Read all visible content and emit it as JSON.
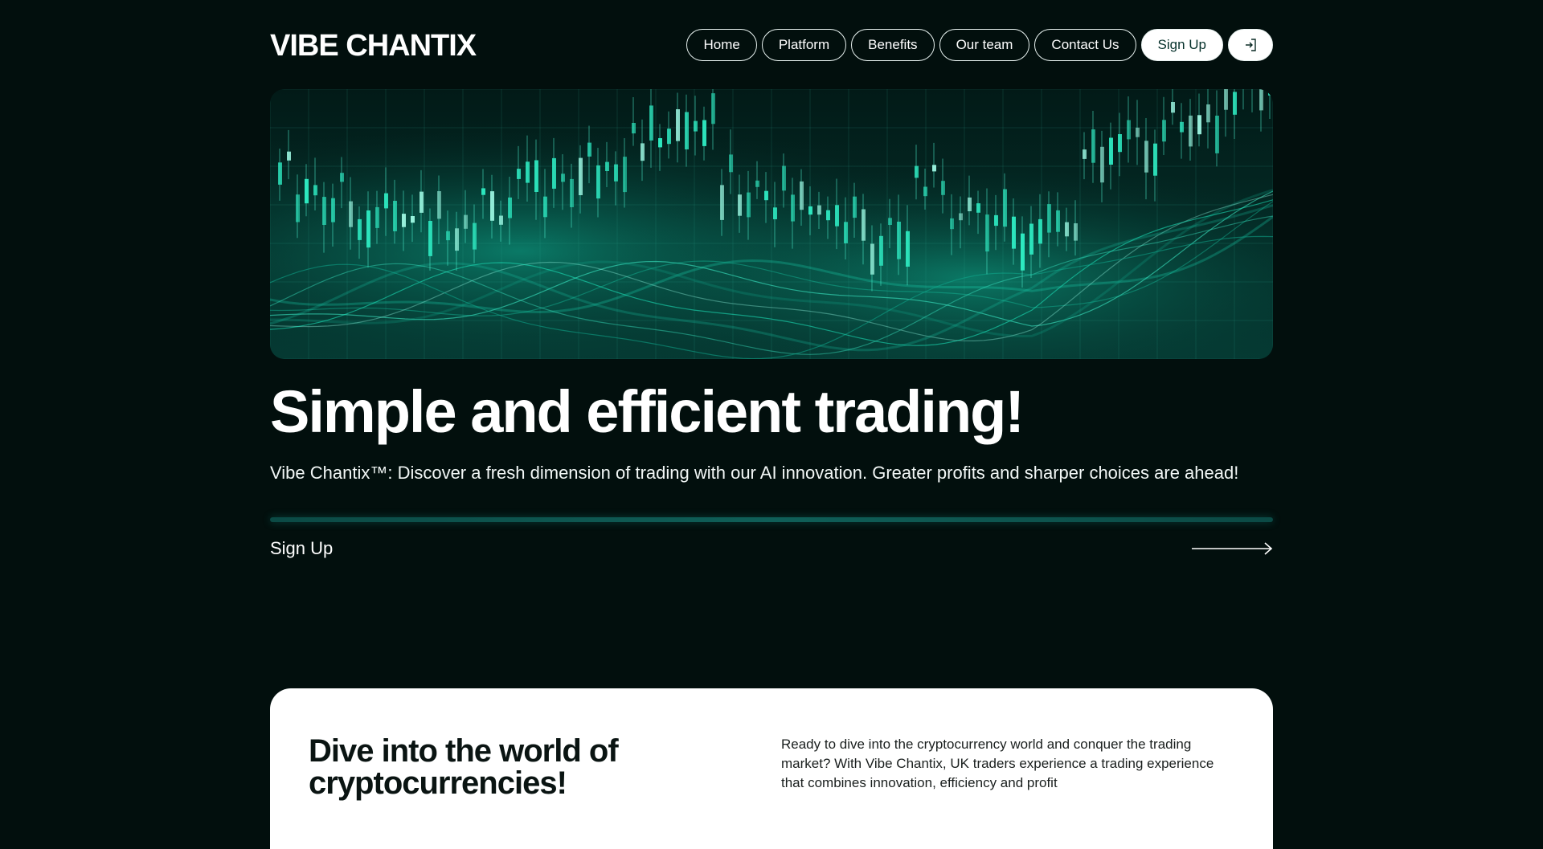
{
  "brand": {
    "logo": "VIBE CHANTIX"
  },
  "nav": {
    "items": [
      "Home",
      "Platform",
      "Benefits",
      "Our team",
      "Contact Us"
    ],
    "signup": "Sign Up",
    "login_icon": "login-icon"
  },
  "hero": {
    "title": "Simple and efficient trading!",
    "subtitle": "Vibe Chantix™: Discover a fresh dimension of trading with our AI innovation. Greater profits and sharper choices are ahead!",
    "cta": "Sign Up",
    "cta_icon": "arrow-right-icon"
  },
  "section": {
    "title": "Dive into the world of cryptocurrencies!",
    "text": "Ready to dive into the cryptocurrency world and conquer the trading market? With Vibe Chantix, UK traders experience a trading experience that combines innovation, efficiency and profit"
  },
  "colors": {
    "background": "#020f0d",
    "accent": "#1de9c0",
    "card": "#ffffff"
  }
}
